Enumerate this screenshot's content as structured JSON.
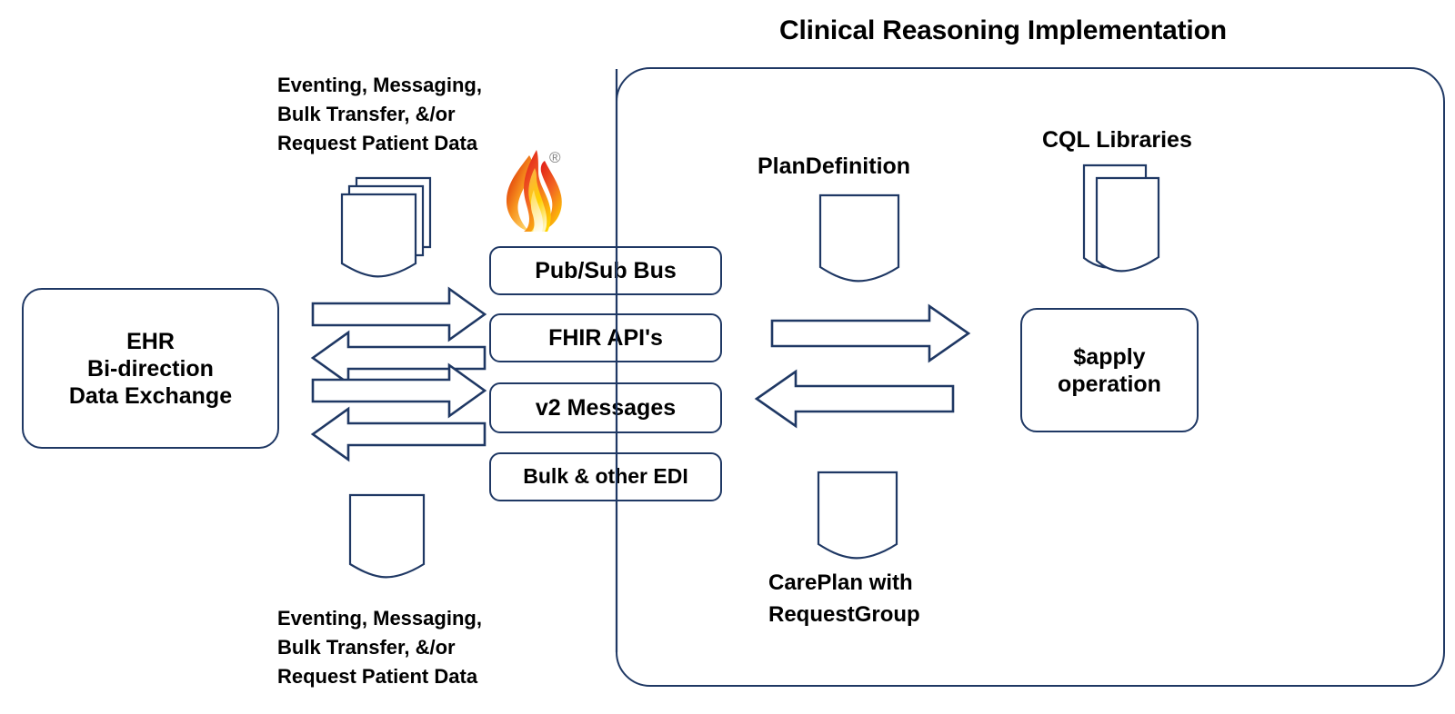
{
  "diagram": {
    "title": "Clinical Reasoning Implementation",
    "accent_color": "#1F3864",
    "background_color": "#FFFFFF"
  },
  "left": {
    "ehr_box_label": "EHR\nBi-direction\nData Exchange",
    "top_note": "Eventing, Messaging,\nBulk Transfer, &/or\nRequest Patient Data",
    "bottom_note": "Eventing, Messaging,\nBulk Transfer, &/or\nRequest Patient Data",
    "fhir_logo_name": "fhir-flame-logo",
    "fhir_registered_mark": "®"
  },
  "center_boxes": [
    {
      "label": "Pub/Sub Bus"
    },
    {
      "label": "FHIR API's"
    },
    {
      "label": "v2 Messages"
    },
    {
      "label": "Bulk & other EDI"
    }
  ],
  "left_arrows": [
    {
      "direction": "right"
    },
    {
      "direction": "left"
    },
    {
      "direction": "right"
    },
    {
      "direction": "left"
    }
  ],
  "right_arrows": [
    {
      "direction": "right"
    },
    {
      "direction": "left"
    }
  ],
  "right": {
    "plan_definition_label": "PlanDefinition",
    "cql_libraries_label": "CQL Libraries",
    "apply_operation_label": "$apply\noperation",
    "careplan_label": "CarePlan with\nRequestGroup"
  }
}
